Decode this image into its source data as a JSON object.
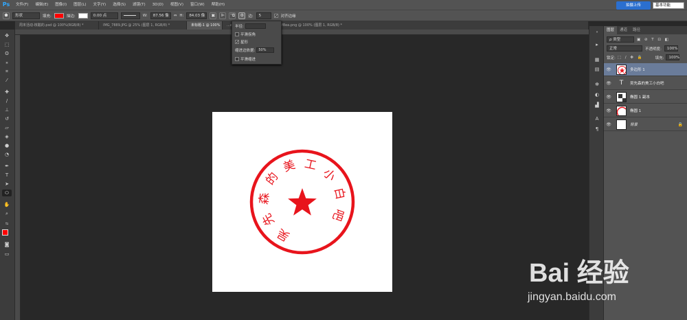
{
  "app": {
    "logo": "Ps"
  },
  "menu": [
    "文件(F)",
    "编辑(E)",
    "图像(I)",
    "图层(L)",
    "文字(Y)",
    "选择(S)",
    "滤镜(T)",
    "3D(D)",
    "视图(V)",
    "窗口(W)",
    "帮助(H)"
  ],
  "window_controls": [
    "—",
    "□",
    "✕"
  ],
  "options": {
    "shape_mode": "形状",
    "fill_label": "填充:",
    "fill_color": "#ff0000",
    "stroke_label": "描边:",
    "stroke_width": "0.00 点",
    "w_label": "W:",
    "w_value": "87.56 像",
    "h_label": "H:",
    "h_value": "84.03 像",
    "sides_label": "边:",
    "sides_value": "5",
    "align_edges_label": "对齐边缘",
    "upload_label": "拍摄上传",
    "workspace": "基本功能"
  },
  "tabs": [
    {
      "label": "周末活动-核酸的.psd @ 100%(RGB/8) *",
      "active": false
    },
    {
      "label": "IMG_7889.JPG @ 25% (图层 1, RGB/8) *",
      "active": false
    },
    {
      "label": "未标题-1 @ 100%",
      "active": true
    },
    {
      "label": "...a260c76e54c9df2afd057e093f8ea.png @ 100% (图层 1, RGB/8) *",
      "active": false
    }
  ],
  "popup": {
    "radius_label": "半径:",
    "smooth_corners_label": "平滑拐角",
    "star_label": "星形",
    "star_checked": true,
    "indent_label": "缩进边依据:",
    "indent_value": "50%",
    "smooth_indent_label": "平滑缩进"
  },
  "seal": {
    "text_chars": [
      "吴",
      "先",
      "森",
      "的",
      "美",
      "工",
      "小",
      "白",
      "吧"
    ],
    "color": "#e8141c"
  },
  "layers_panel": {
    "tabs": [
      "图层",
      "通道",
      "路径"
    ],
    "kind_label": "ρ 类型",
    "blend_mode": "正常",
    "opacity_label": "不透明度:",
    "opacity_value": "100%",
    "lock_label": "锁定:",
    "fill_label": "填充:",
    "fill_value": "100%",
    "layers": [
      {
        "name": "多边形 1",
        "selected": true,
        "thumb": "star"
      },
      {
        "name": "吴先森的美工小白吧",
        "selected": false,
        "thumb": "text"
      },
      {
        "name": "椭圆 1 副本",
        "selected": false,
        "thumb": "shape"
      },
      {
        "name": "椭圆 1",
        "selected": false,
        "thumb": "ellipse"
      },
      {
        "name": "背景",
        "selected": false,
        "thumb": "white"
      }
    ]
  },
  "watermark": {
    "text": "Bai 经验",
    "url": "jingyan.baidu.com"
  }
}
